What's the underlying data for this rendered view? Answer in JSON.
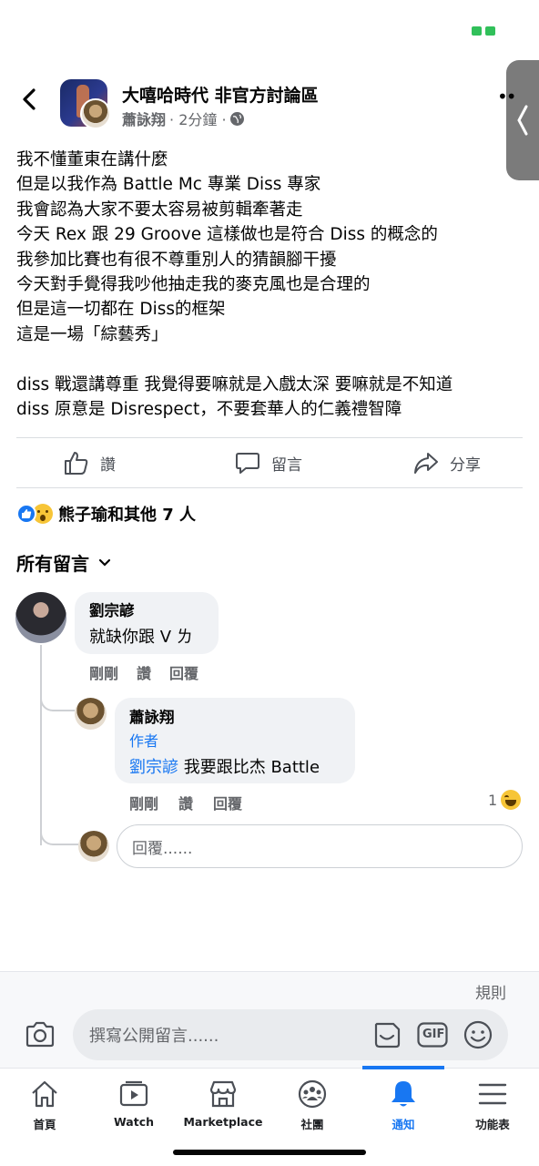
{
  "header": {
    "group_name": "大嘻哈時代 非官方討論區",
    "author": "蕭詠翔",
    "time": "· 2分鐘 ·"
  },
  "post": {
    "lines": [
      "我不懂董東在講什麼",
      "但是以我作為 Battle Mc 專業 Diss 專家",
      "我會認為大家不要太容易被剪輯牽著走",
      "今天 Rex 跟 29 Groove 這樣做也是符合 Diss 的概念的",
      "我參加比賽也有很不尊重別人的猜韻腳干擾",
      "今天對手覺得我吵他抽走我的麥克風也是合理的",
      "但是這一切都在 Diss的框架",
      "這是一場「綜藝秀」",
      "",
      "diss 戰還講尊重 我覺得要嘛就是入戲太深 要嘛就是不知道",
      "diss 原意是 Disrespect，不要套華人的仁義禮智障"
    ]
  },
  "actions": {
    "like": "讚",
    "comment": "留言",
    "share": "分享"
  },
  "reactions": {
    "summary": "熊子瑜和其他 7 人"
  },
  "comments_header": {
    "label": "所有留言"
  },
  "comments": [
    {
      "name": "劉宗諺",
      "text": "就缺你跟 V ㄌ",
      "time": "剛剛",
      "like": "讚",
      "reply": "回覆"
    },
    {
      "name": "蕭詠翔",
      "badge": "作者",
      "mention": "劉宗諺",
      "text": " 我要跟比杰 Battle",
      "time": "剛剛",
      "like": "讚",
      "reply": "回覆",
      "reaction_count": "1"
    }
  ],
  "reply_box": {
    "placeholder": "回覆......"
  },
  "composer": {
    "rules": "規則",
    "placeholder": "撰寫公開留言......",
    "gif": "GIF"
  },
  "nav": {
    "items": [
      {
        "label": "首頁",
        "icon": "home-icon"
      },
      {
        "label": "Watch",
        "icon": "watch-icon"
      },
      {
        "label": "Marketplace",
        "icon": "marketplace-icon"
      },
      {
        "label": "社團",
        "icon": "groups-icon"
      },
      {
        "label": "通知",
        "icon": "bell-icon"
      },
      {
        "label": "功能表",
        "icon": "menu-icon"
      }
    ],
    "active": "通知"
  },
  "colors": {
    "accent": "#1877f2",
    "text": "#050505",
    "secondary": "#65676b"
  }
}
